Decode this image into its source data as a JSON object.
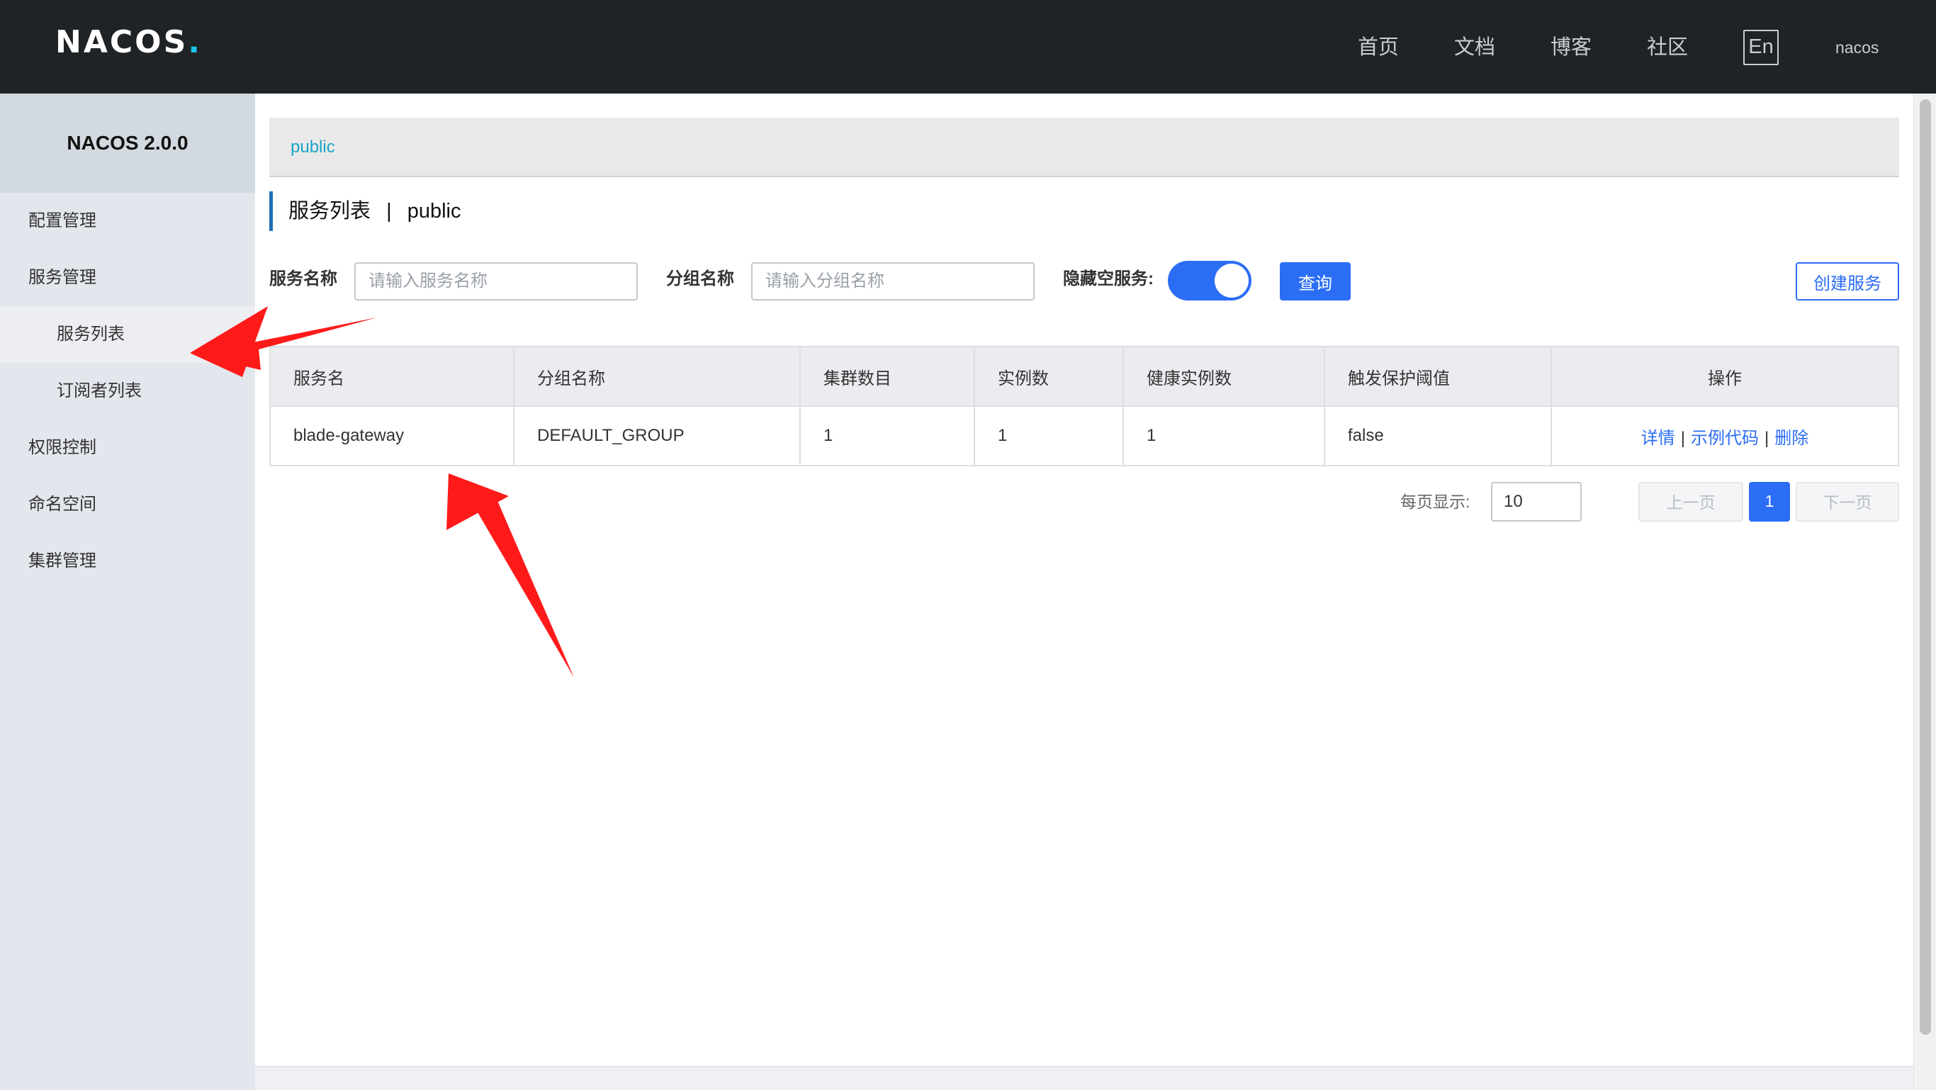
{
  "header": {
    "logo_text": "NACOS",
    "logo_dot": ".",
    "nav": [
      "首页",
      "文档",
      "博客",
      "社区"
    ],
    "lang_label": "En",
    "username": "nacos"
  },
  "sidebar": {
    "title": "NACOS 2.0.0",
    "items": [
      {
        "label": "配置管理"
      },
      {
        "label": "服务管理"
      },
      {
        "label": "服务列表"
      },
      {
        "label": "订阅者列表"
      },
      {
        "label": "权限控制"
      },
      {
        "label": "命名空间"
      },
      {
        "label": "集群管理"
      }
    ]
  },
  "breadcrumb": {
    "namespace": "public"
  },
  "page": {
    "title": "服务列表",
    "separator": "|",
    "namespace": "public"
  },
  "filters": {
    "service_label": "服务名称",
    "service_placeholder": "请输入服务名称",
    "group_label": "分组名称",
    "group_placeholder": "请输入分组名称",
    "hide_empty_label": "隐藏空服务:",
    "hide_empty_on": true,
    "query_button": "查询",
    "create_button": "创建服务"
  },
  "table": {
    "columns": [
      "服务名",
      "分组名称",
      "集群数目",
      "实例数",
      "健康实例数",
      "触发保护阈值",
      "操作"
    ],
    "rows": [
      {
        "service": "blade-gateway",
        "group": "DEFAULT_GROUP",
        "clusters": "1",
        "instances": "1",
        "healthy": "1",
        "threshold": "false",
        "actions": [
          "详情",
          "示例代码",
          "删除"
        ]
      }
    ],
    "action_separator": "|"
  },
  "pager": {
    "size_label": "每页显示:",
    "size_value": "10",
    "prev_label": "上一页",
    "current_page": "1",
    "next_label": "下一页"
  },
  "colors": {
    "header_bg": "#1f2326",
    "accent": "#2b6df5",
    "sidebar_bg": "#e3e6ec",
    "annotation_arrow": "#ff1a1a"
  }
}
